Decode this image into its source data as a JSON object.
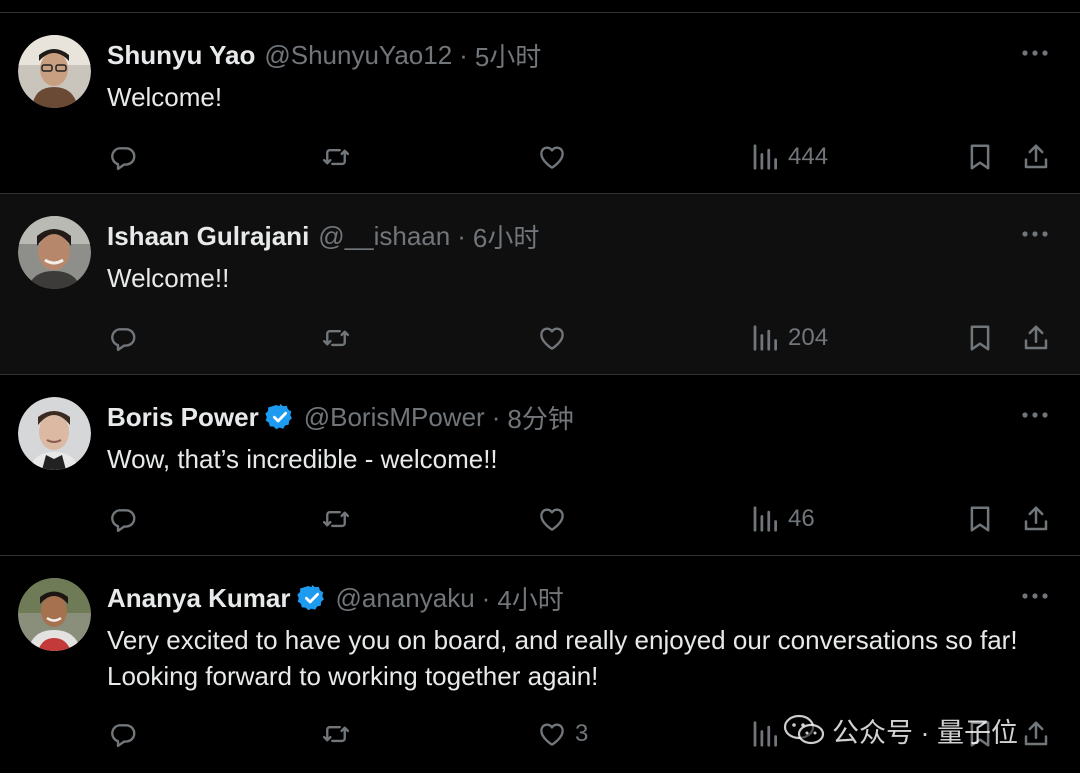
{
  "tweets": [
    {
      "name": "Shunyu Yao",
      "handle": "@ShunyuYao12",
      "dot": "·",
      "time": "5小时",
      "verified": false,
      "text": "Welcome!",
      "likes": "",
      "views": "444"
    },
    {
      "name": "Ishaan Gulrajani",
      "handle": "@__ishaan",
      "dot": "·",
      "time": "6小时",
      "verified": false,
      "text": "Welcome!!",
      "likes": "",
      "views": "204"
    },
    {
      "name": "Boris Power",
      "handle": "@BorisMPower",
      "dot": "·",
      "time": "8分钟",
      "verified": true,
      "text": "Wow, that’s incredible - welcome!!",
      "likes": "",
      "views": "46"
    },
    {
      "name": "Ananya Kumar",
      "handle": "@ananyaku",
      "dot": "·",
      "time": "4小时",
      "verified": true,
      "text": "Very excited to have you on board, and really enjoyed our conversations so far! Looking forward to working together again!",
      "likes": "3",
      "views": ""
    }
  ],
  "watermark": {
    "text": "公众号 · 量子位",
    "icon": "wechat-icon"
  },
  "colors": {
    "background": "#000000",
    "text": "#e7e9ea",
    "muted": "#71767b",
    "divider": "#2f3336",
    "verified": "#1d9bf0"
  }
}
